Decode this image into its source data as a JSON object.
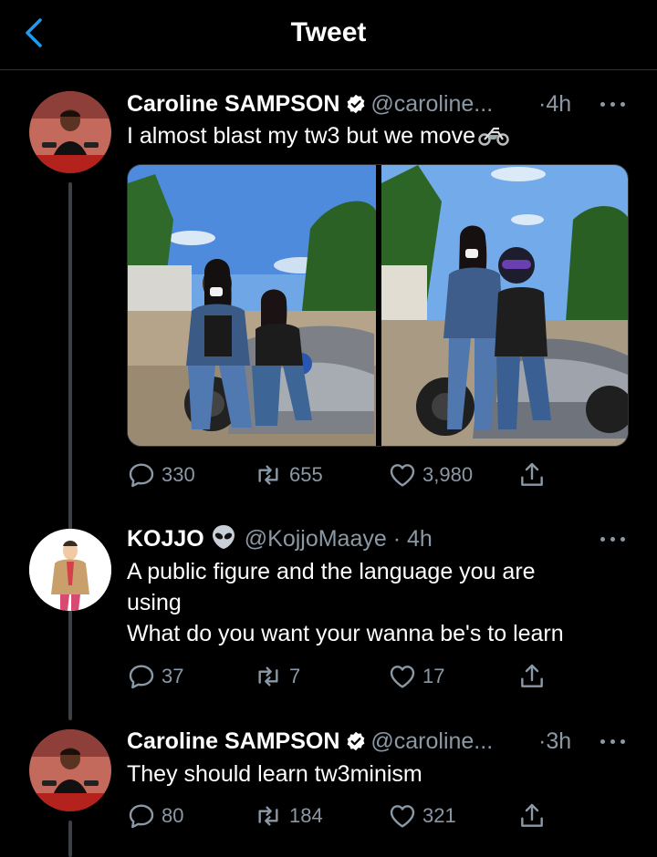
{
  "header": {
    "title": "Tweet",
    "back_icon": "chevron-left-icon",
    "accent": "#1d9bf0"
  },
  "colors": {
    "background": "#000000",
    "text": "#ffffff",
    "secondary": "#8b98a5",
    "verified": "#ffffff"
  },
  "tweets": [
    {
      "name": "Caroline SAMPSON",
      "verified": true,
      "handle": "@caroline...",
      "sep": "·",
      "time": "4h",
      "text": [
        "I almost blast my tw3 but we move"
      ],
      "emoji": "motorcycle",
      "media": [
        {
          "alt": "two women posing on a motorcycle"
        },
        {
          "alt": "two women on a motorcycle, one wearing a helmet"
        }
      ],
      "replies": "330",
      "retweets": "655",
      "likes": "3,980"
    },
    {
      "name": "KOJJO",
      "badge_emoji": "alien",
      "handle": "@KojjoMaaye",
      "sep": "·",
      "time": "4h",
      "text": [
        "A public figure and the language you are",
        "using",
        "What do you want your wanna be's to learn"
      ],
      "replies": "37",
      "retweets": "7",
      "likes": "17"
    },
    {
      "name": "Caroline SAMPSON",
      "verified": true,
      "handle": "@caroline...",
      "sep": "·",
      "time": "3h",
      "text": [
        "They should learn tw3minism"
      ],
      "replies": "80",
      "retweets": "184",
      "likes": "321"
    }
  ]
}
